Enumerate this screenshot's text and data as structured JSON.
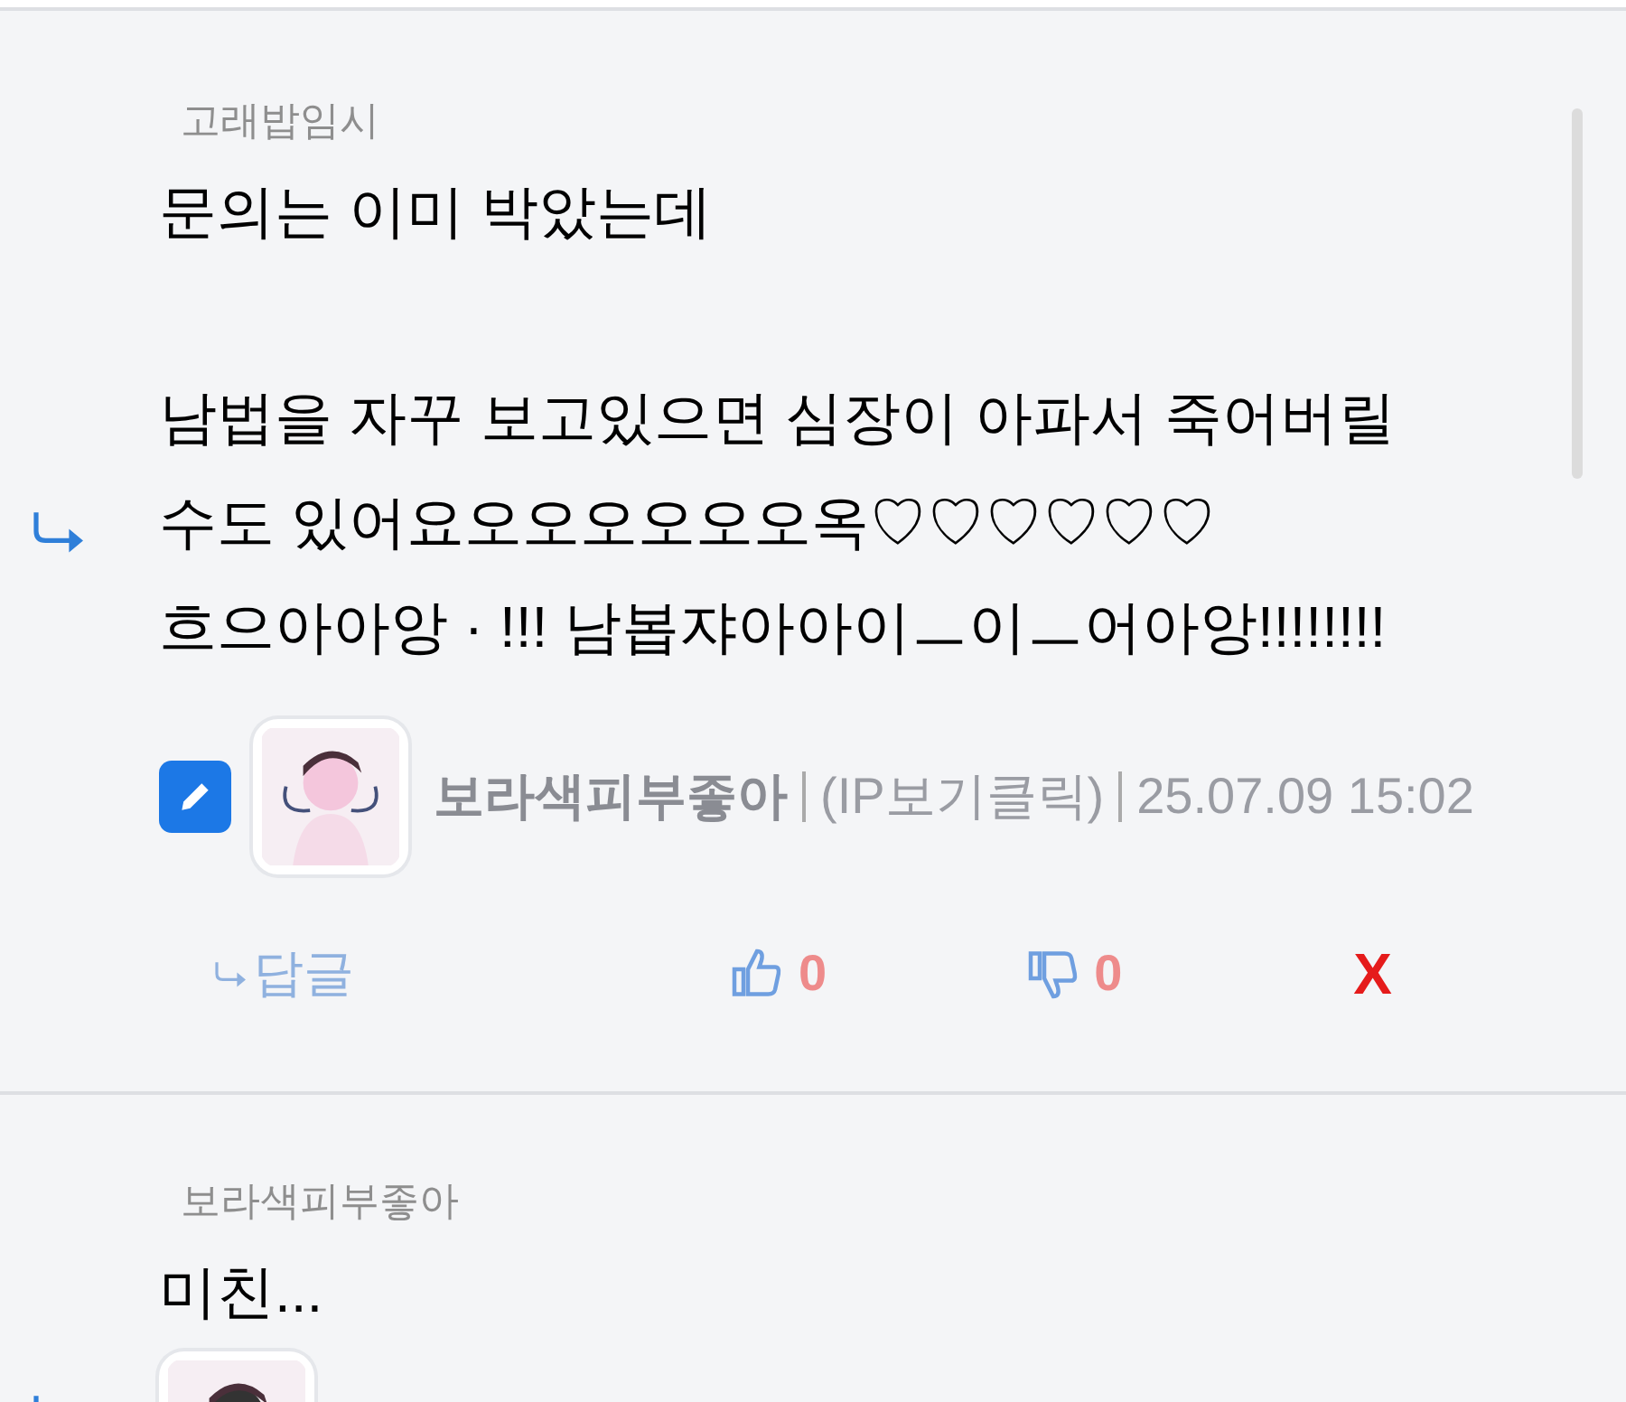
{
  "comments": [
    {
      "reply_to": "고래밥임시",
      "paragraphs": [
        [
          "문의는 이미 박았는데"
        ],
        [
          "남법을 자꾸 보고있으면 심장이 아파서 죽어버릴",
          "수도 있어요오오오오오오옥♡♡♡♡♡♡",
          "흐으아아앙 · !!! 남봅쟈아아이ㅡ이ㅡ어아앙!!!!!!!!"
        ]
      ],
      "author": "보라색피부좋아",
      "ip": "(IP보기클릭)",
      "date": "25.07.09 15:02",
      "reply_label": "답글",
      "likes": "0",
      "dislikes": "0",
      "delete_label": "X"
    },
    {
      "reply_to": "보라색피부좋아",
      "paragraphs": [
        [
          "미친..."
        ]
      ]
    }
  ]
}
